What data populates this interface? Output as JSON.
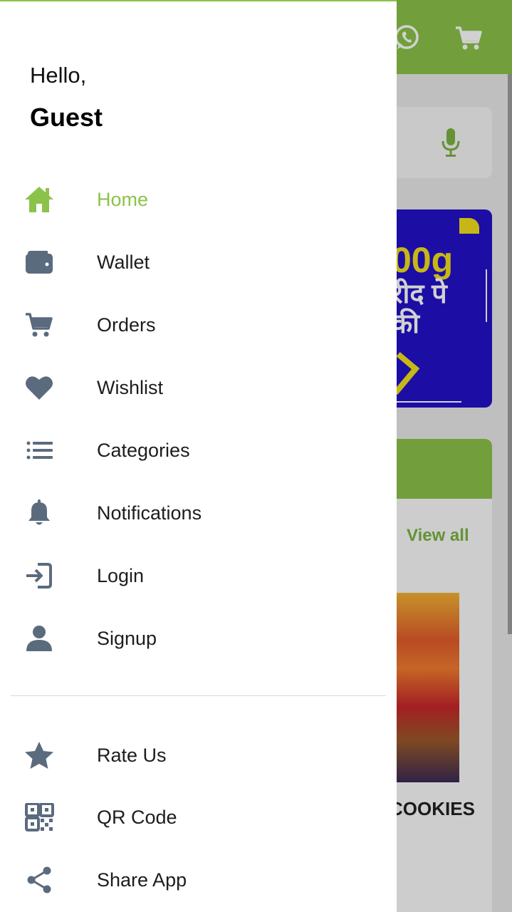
{
  "app": {
    "view_all": "View all",
    "product_name": "COOKIES",
    "banner": {
      "big": "00g",
      "line2": "रीद पे",
      "line3": "की"
    }
  },
  "drawer": {
    "greeting": "Hello,",
    "user_name": "Guest",
    "menu": [
      {
        "label": "Home",
        "icon": "home-icon",
        "active": true
      },
      {
        "label": "Wallet",
        "icon": "wallet-icon"
      },
      {
        "label": "Orders",
        "icon": "cart-icon"
      },
      {
        "label": "Wishlist",
        "icon": "heart-icon"
      },
      {
        "label": "Categories",
        "icon": "list-icon"
      },
      {
        "label": "Notifications",
        "icon": "bell-icon"
      },
      {
        "label": "Login",
        "icon": "login-icon"
      },
      {
        "label": "Signup",
        "icon": "user-icon"
      }
    ],
    "secondary": [
      {
        "label": "Rate Us",
        "icon": "star-icon"
      },
      {
        "label": "QR Code",
        "icon": "qr-code-icon"
      },
      {
        "label": "Share App",
        "icon": "share-icon"
      }
    ]
  },
  "colors": {
    "accent": "#8bc34a",
    "icon_gray": "#5b6b7e",
    "banner_blue": "#2310c9",
    "banner_yellow": "#f3e01c"
  }
}
